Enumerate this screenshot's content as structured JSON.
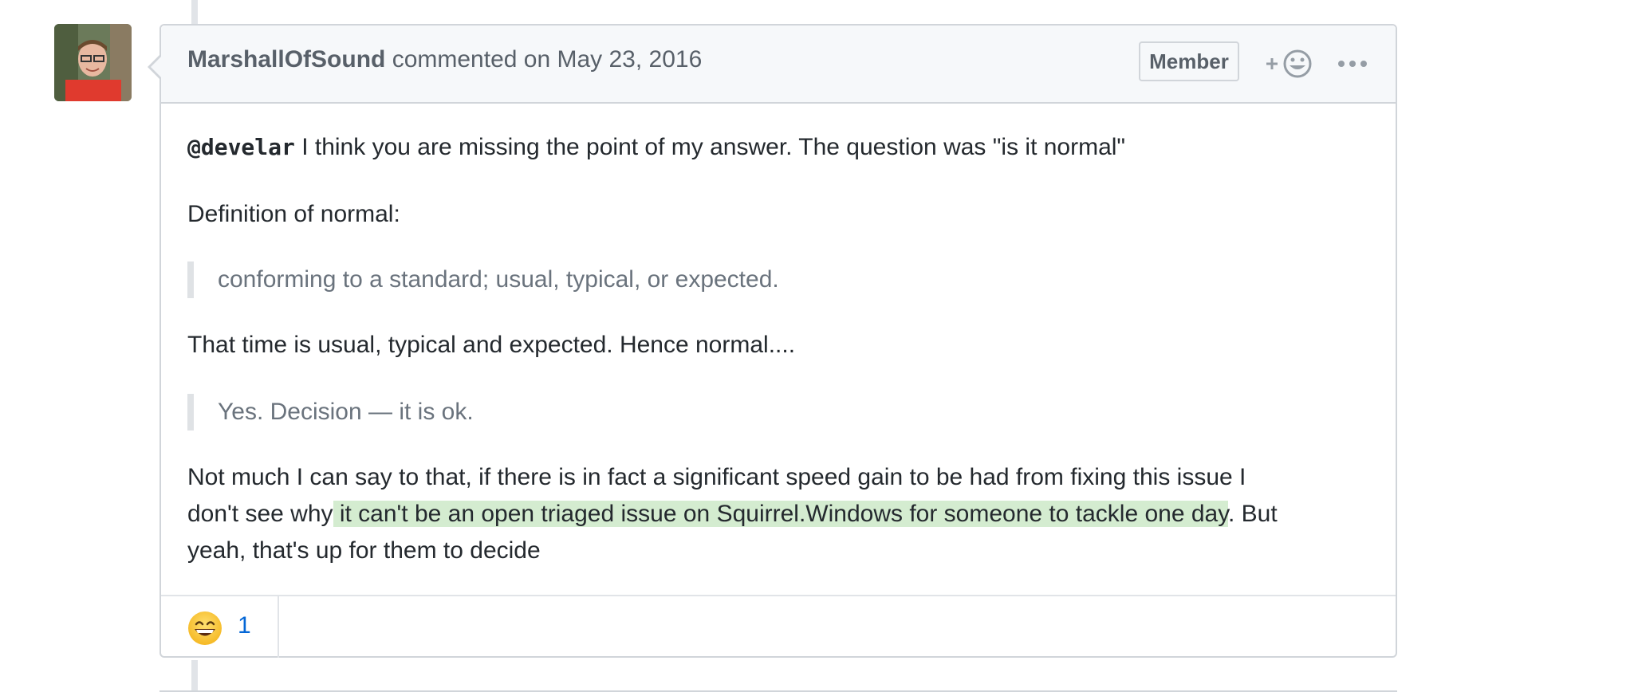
{
  "comment": {
    "author": "MarshallOfSound",
    "action_text": "commented on May 23, 2016",
    "badge": "Member",
    "body": {
      "p1_mention": "@develar",
      "p1_text": " I think you are missing the point of my answer. The question was \"is it normal\"",
      "p2": "Definition of normal:",
      "quote1": "conforming to a standard; usual, typical, or expected.",
      "p3": "That time is usual, typical and expected. Hence normal....",
      "quote2": "Yes. Decision — it is ok.",
      "p4_line1": "Not much I can say to that, if there is in fact a significant speed gain to be had from fixing this issue I",
      "p4_line2_pre": "don't see why",
      "p4_line2_highlight": " it can't be an open triaged issue on Squirrel.Windows for someone to tackle one day",
      "p4_line2_post": ". But",
      "p4_line3": "yeah, that's up for them to decide"
    },
    "reactions": [
      {
        "emoji": "grinning-face-icon",
        "count": "1"
      }
    ]
  },
  "colors": {
    "highlight": "#d4ecd0",
    "link": "#0366d6",
    "border": "#d1d5da",
    "header_bg": "#f6f8fa"
  }
}
